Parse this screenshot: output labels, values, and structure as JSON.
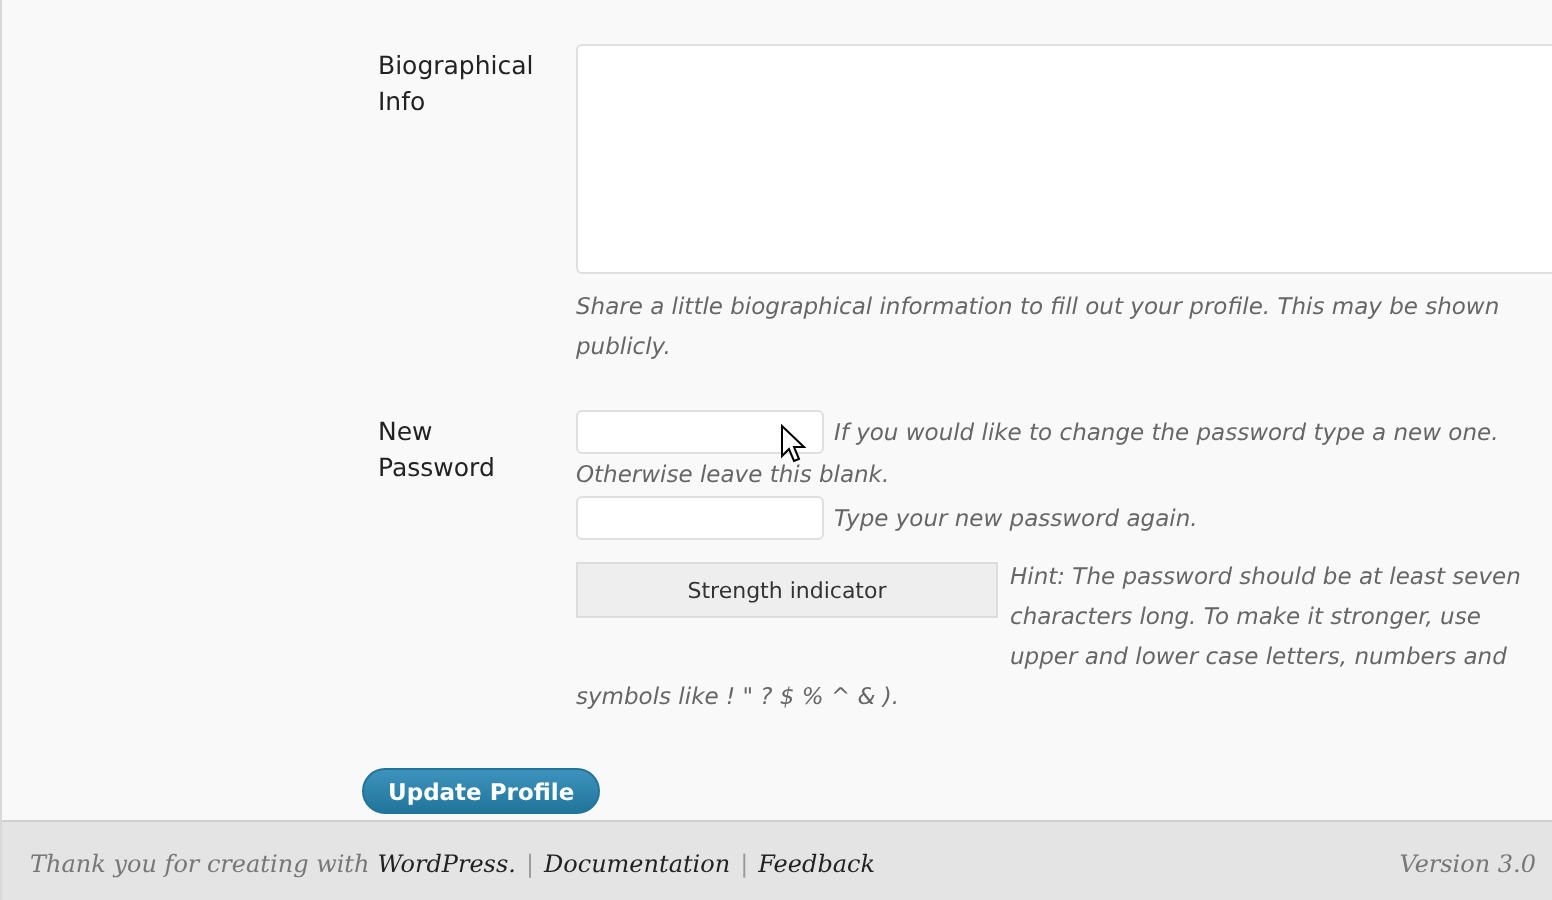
{
  "fields": [
    {
      "kind": "textarea",
      "label": "Biographical Info",
      "description": "Share a little biographical information to fill out your profile. This may be shown publicly."
    },
    {
      "kind": "password",
      "label": "New Password",
      "first_hint": [
        "If you would like to change the password type a new one.",
        "Otherwise leave this blank."
      ],
      "second_hint": "Type your new password again.",
      "strength": "Strength indicator",
      "strength_hint": [
        "Hint: The password should be at least seven characters long. To make it stronger, use upper and lower case letters, numbers and",
        "symbols like ! \" ? $ % ^ & )."
      ]
    }
  ],
  "submit": "Update Profile",
  "footer": {
    "thanks": "Thank you for creating with",
    "links": [
      "WordPress.",
      "Documentation",
      "Feedback"
    ],
    "separator": "|",
    "version": "Version 3.0"
  }
}
